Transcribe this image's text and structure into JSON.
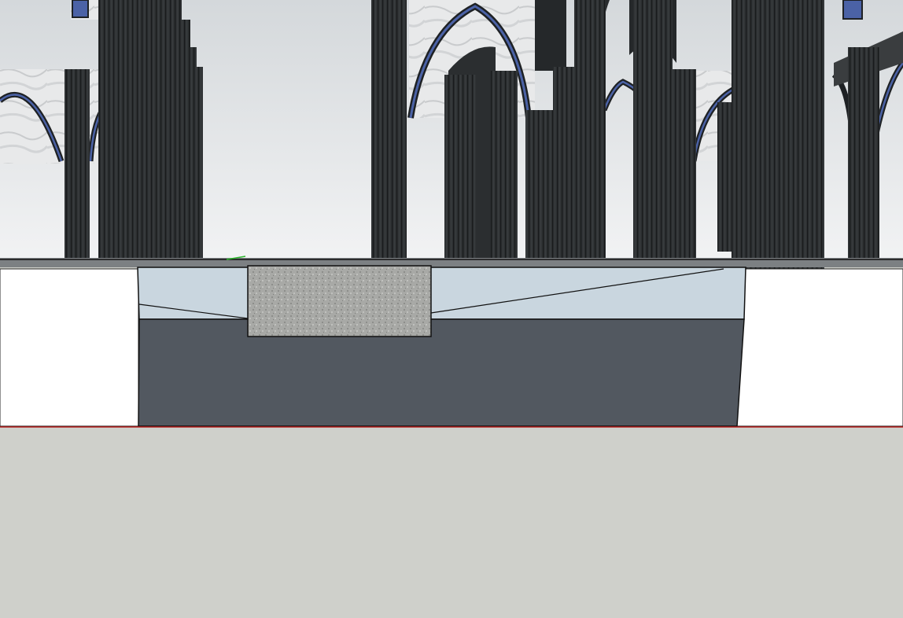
{
  "viewport": {
    "kind": "3d-modeling-viewport",
    "scene": "gothic-cathedral-arcade",
    "camera": "perspective-eye-level"
  },
  "colors": {
    "sky_top": "#d7dadd",
    "sky_bottom": "#eef0f1",
    "ground": "#cfd0cb",
    "column": "#2f3234",
    "column_stripe": "#1a1c1d",
    "column_edge": "#4a4e50",
    "arch_stone": "#1e2124",
    "arch_trim": "#4b62a6",
    "wall_marble": "#e6e7e8",
    "floor_slab": "#d9dcdd",
    "plinth_white": "#ffffff",
    "pit_wall": "#525860",
    "pit_floor": "#c9d6df",
    "stone_block": "#a9aaa7",
    "red_axis": "#b31a1a",
    "green_axis": "#2bb52b"
  },
  "icons": {
    "green_axis": "green-axis-marker-icon",
    "red_axis": "red-axis-line-icon"
  }
}
